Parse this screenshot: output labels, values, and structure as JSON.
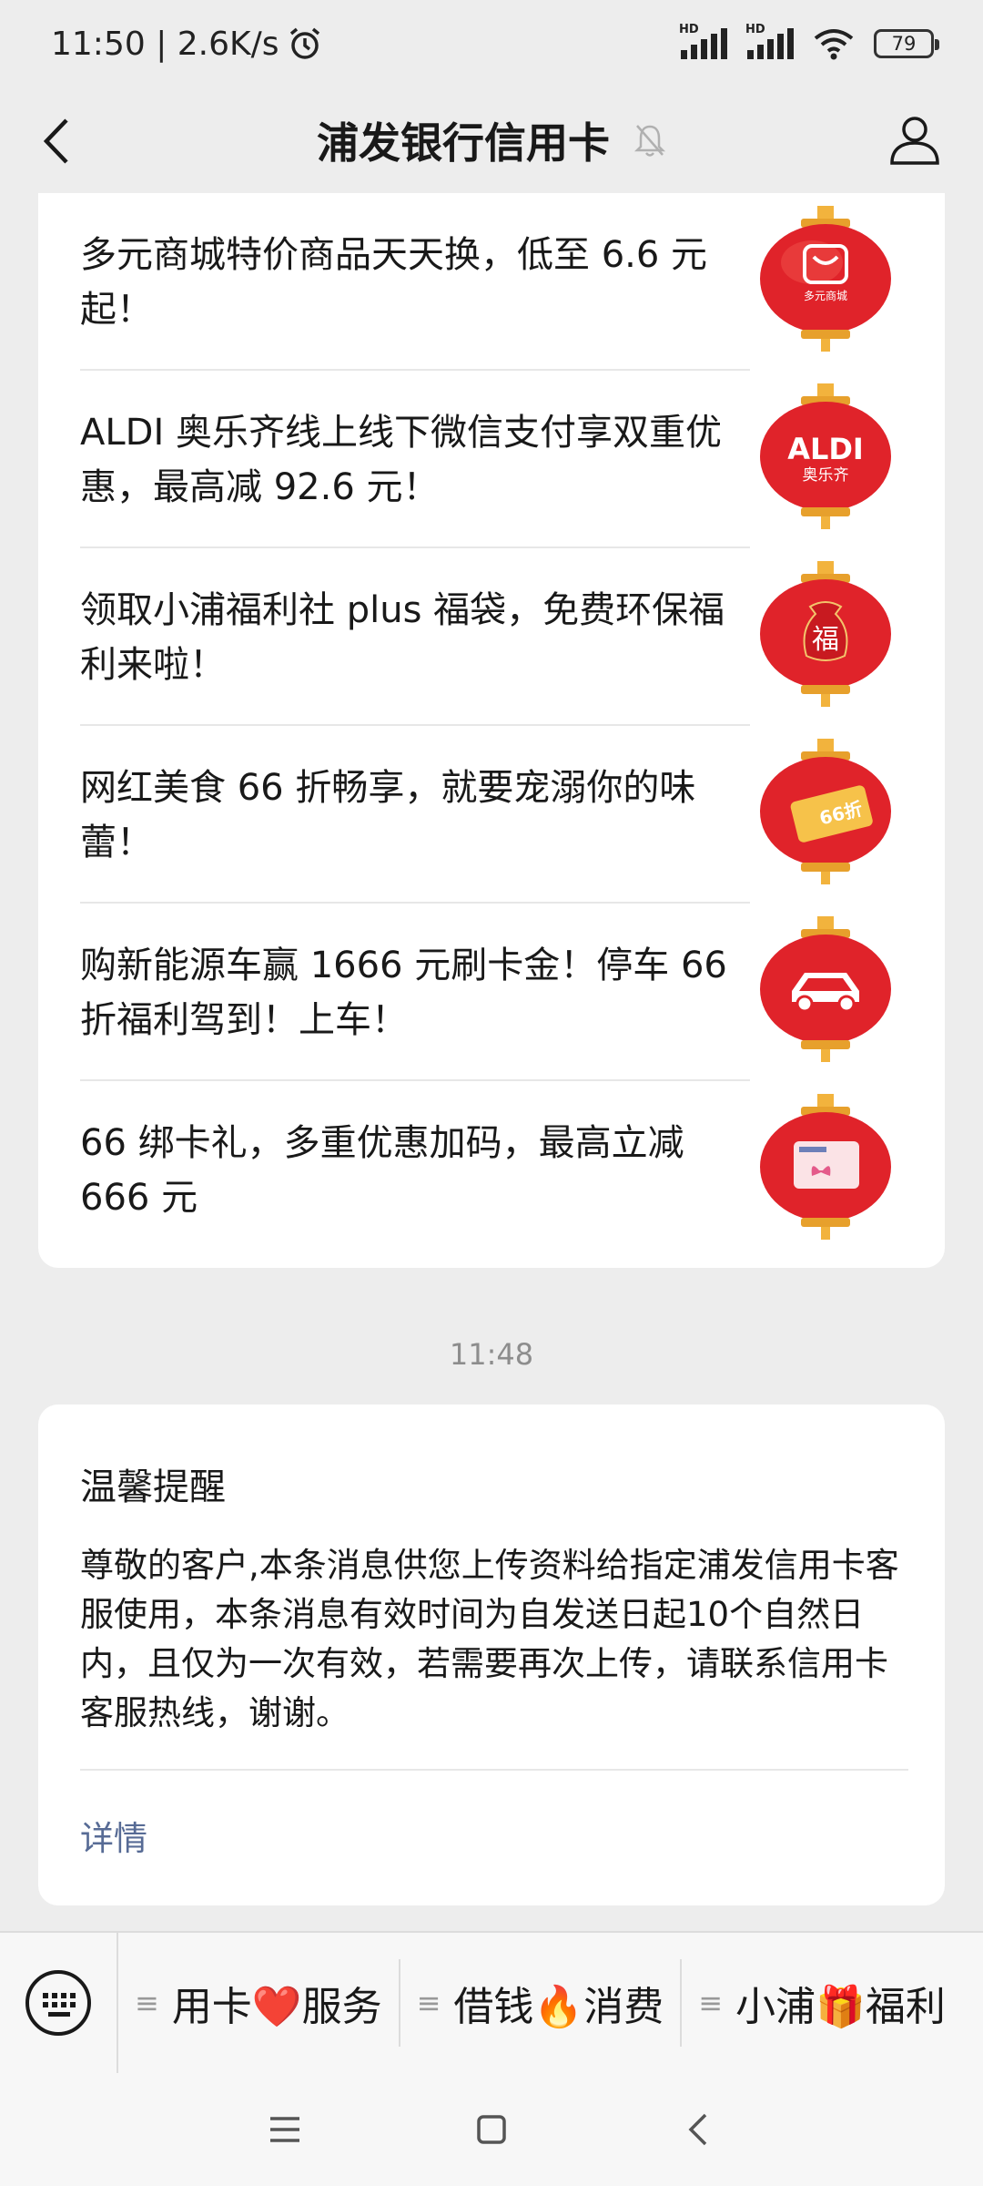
{
  "status_bar": {
    "time_speed": "11:50 | 2.6K/s",
    "battery": "79",
    "hd1": "HD",
    "hd2": "HD"
  },
  "header": {
    "title": "浦发银行信用卡"
  },
  "articles": [
    {
      "text": "多元商城特价商品天天换，低至 6.6 元起！",
      "icon_label": "多元商城",
      "icon": "shopping-bag-lantern"
    },
    {
      "text": "ALDI 奥乐齐线上线下微信支付享双重优惠，最高减 92.6 元！",
      "icon_label": "ALDI",
      "icon_sub": "奥乐齐",
      "icon": "aldi-lantern"
    },
    {
      "text": "领取小浦福利社 plus 福袋，免费环保福利来啦！",
      "icon_label": "福",
      "icon": "lucky-bag-lantern"
    },
    {
      "text": "网红美食 66 折畅享，就要宠溺你的味蕾！",
      "icon_label": "66折",
      "icon": "coupon-lantern"
    },
    {
      "text": "购新能源车赢 1666 元刷卡金！停车 66 折福利驾到！上车！",
      "icon": "car-lantern"
    },
    {
      "text": "66 绑卡礼，多重优惠加码，最高立减 666 元",
      "icon": "card-gift-lantern"
    }
  ],
  "timestamp": "11:48",
  "notice": {
    "title": "温馨提醒",
    "body": "尊敬的客户,本条消息供您上传资料给指定浦发信用卡客服使用，本条消息有效时间为自发送日起10个自然日内，且仅为一次有效，若需要再次上传，请联系信用卡客服热线，谢谢。",
    "link": "详情"
  },
  "menu": [
    {
      "label": "用卡❤️服务"
    },
    {
      "label": "借钱🔥消费"
    },
    {
      "label": "小浦🎁福利"
    }
  ],
  "colors": {
    "background": "#ededed",
    "card": "#ffffff",
    "link": "#576b95",
    "lantern_red": "#e0232a",
    "lantern_gold": "#f2b33d"
  }
}
